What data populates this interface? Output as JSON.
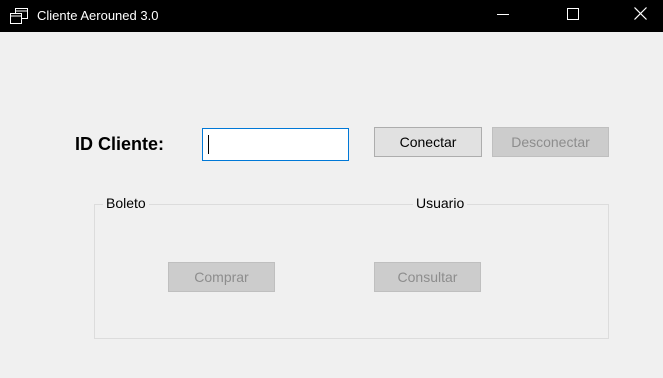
{
  "window": {
    "title": "Cliente Aerouned 3.0",
    "icons": {
      "app": "app-window-icon",
      "minimize": "minimize-icon",
      "maximize": "maximize-icon",
      "close": "close-icon"
    }
  },
  "form": {
    "id_label": "ID Cliente:",
    "id_value": "",
    "connect_label": "Conectar",
    "disconnect_label": "Desconectar"
  },
  "groups": {
    "boleto_label": "Boleto",
    "usuario_label": "Usuario",
    "buy_label": "Comprar",
    "query_label": "Consultar"
  },
  "colors": {
    "titlebar": "#000000",
    "focus_border": "#0078d7",
    "disabled_text": "#8d8d8d",
    "window_bg": "#f0f0f0"
  }
}
